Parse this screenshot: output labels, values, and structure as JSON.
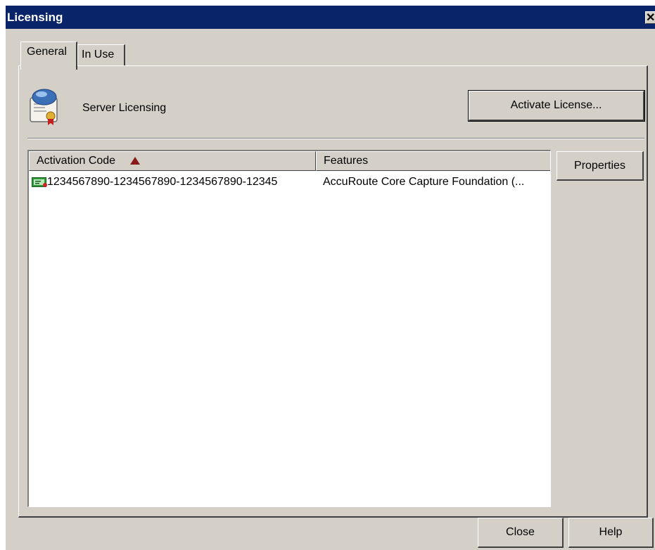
{
  "window": {
    "title": "Licensing",
    "close_glyph": "✕"
  },
  "tabs": [
    {
      "label": "General",
      "selected": true
    },
    {
      "label": "In Use",
      "selected": false
    }
  ],
  "header": {
    "icon": "server-license-icon",
    "label": "Server Licensing",
    "activate_button": "Activate License..."
  },
  "list": {
    "columns": [
      {
        "label": "Activation Code",
        "sorted": "ascending"
      },
      {
        "label": "Features"
      }
    ],
    "rows": [
      {
        "icon": "license-key-icon",
        "activation_code": "1234567890-1234567890-1234567890-12345",
        "features": "AccuRoute Core Capture Foundation (..."
      }
    ]
  },
  "side_buttons": {
    "properties": "Properties"
  },
  "footer": {
    "close": "Close",
    "help": "Help"
  },
  "colors": {
    "titlebar": "#0a246a",
    "dialog_face": "#d4d0c8",
    "sort_arrow": "#8b1a1a"
  }
}
